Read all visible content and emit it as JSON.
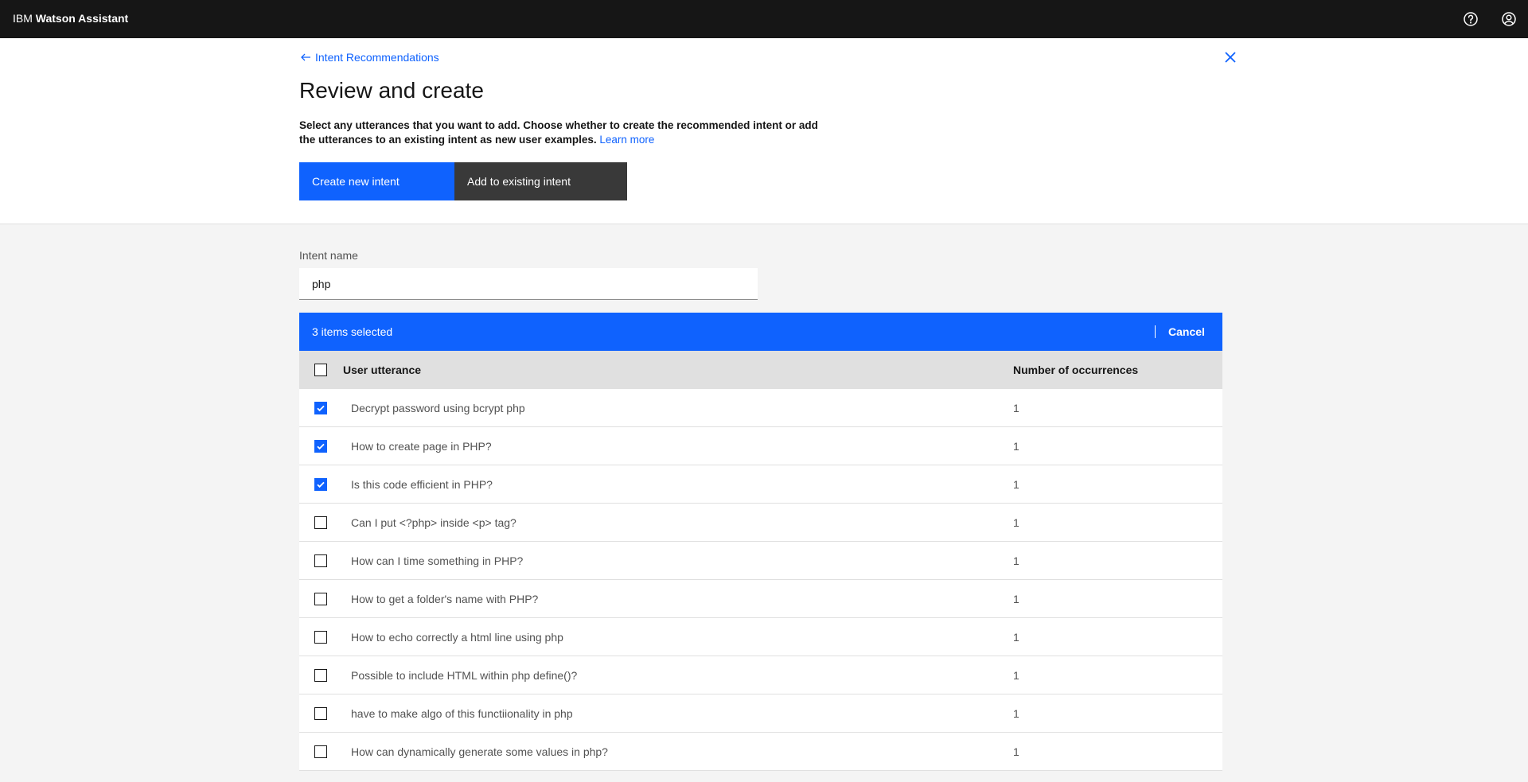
{
  "app": {
    "brand_prefix": "IBM",
    "brand_name": "Watson Assistant"
  },
  "header": {
    "back_link": "Intent Recommendations",
    "title": "Review and create",
    "description": "Select any utterances that you want to add. Choose whether to create the recommended intent or add the utterances to an existing intent as new user examples.",
    "learn_more": "Learn more",
    "create_new_label": "Create new intent",
    "add_existing_label": "Add to existing intent"
  },
  "form": {
    "intent_label": "Intent name",
    "intent_value": "php"
  },
  "batch": {
    "count_label": "3 items selected",
    "cancel_label": "Cancel"
  },
  "table": {
    "col_utterance": "User utterance",
    "col_occurrences": "Number of occurrences",
    "rows": [
      {
        "utterance": "Decrypt password using bcrypt php",
        "occurrences": "1",
        "checked": true
      },
      {
        "utterance": "How to create page in PHP?",
        "occurrences": "1",
        "checked": true
      },
      {
        "utterance": "Is this code efficient in PHP?",
        "occurrences": "1",
        "checked": true
      },
      {
        "utterance": "Can I put <?php> inside <p> tag?",
        "occurrences": "1",
        "checked": false
      },
      {
        "utterance": "How can I time something in PHP?",
        "occurrences": "1",
        "checked": false
      },
      {
        "utterance": "How to get a folder's name with PHP?",
        "occurrences": "1",
        "checked": false
      },
      {
        "utterance": "How to echo correctly a html line using php",
        "occurrences": "1",
        "checked": false
      },
      {
        "utterance": "Possible to include HTML within php define()?",
        "occurrences": "1",
        "checked": false
      },
      {
        "utterance": "have to make algo of this functiionality in php",
        "occurrences": "1",
        "checked": false
      },
      {
        "utterance": "How can dynamically generate some values in php?",
        "occurrences": "1",
        "checked": false
      }
    ]
  },
  "colors": {
    "primary": "#0f62fe",
    "topbar": "#161616",
    "secondary_button": "#393939"
  },
  "icons": {
    "help": "help-icon",
    "user": "user-avatar-icon",
    "back": "arrow-left-icon",
    "close": "close-icon",
    "checkmark": "checkmark-icon"
  }
}
